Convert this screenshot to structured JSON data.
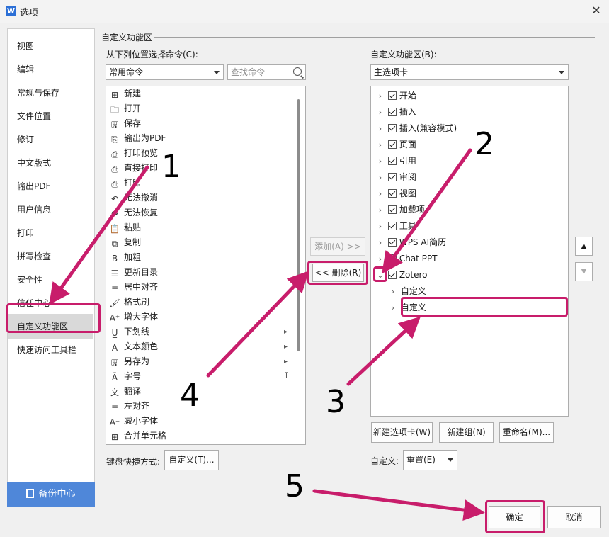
{
  "window": {
    "logo": "W",
    "title": "选项",
    "close_icon": "close-icon"
  },
  "nav": {
    "items": [
      "视图",
      "编辑",
      "常规与保存",
      "文件位置",
      "修订",
      "中文版式",
      "输出PDF",
      "用户信息",
      "打印",
      "拼写检查",
      "安全性",
      "信任中心",
      "自定义功能区",
      "快速访问工具栏"
    ],
    "active_index": 12,
    "backup_label": "备份中心"
  },
  "section": {
    "title": "自定义功能区"
  },
  "left": {
    "label": "从下列位置选择命令(C):",
    "combo_value": "常用命令",
    "search_placeholder": "查找命令",
    "commands": [
      {
        "icon": "new-icon",
        "glyph": "⊞",
        "label": "新建"
      },
      {
        "icon": "open-icon",
        "glyph": "🗀",
        "label": "打开"
      },
      {
        "icon": "save-icon",
        "glyph": "🖫",
        "label": "保存"
      },
      {
        "icon": "export-pdf-icon",
        "glyph": "⎘",
        "label": "输出为PDF"
      },
      {
        "icon": "print-preview-icon",
        "glyph": "⎙",
        "label": "打印预览"
      },
      {
        "icon": "direct-print-icon",
        "glyph": "⎙",
        "label": "直接打印"
      },
      {
        "icon": "print-icon",
        "glyph": "⎙",
        "label": "打印"
      },
      {
        "icon": "undo-icon",
        "glyph": "↶",
        "label": "无法撤消"
      },
      {
        "icon": "redo-icon",
        "glyph": "↷",
        "label": "无法恢复"
      },
      {
        "icon": "paste-icon",
        "glyph": "📋",
        "label": "粘贴"
      },
      {
        "icon": "copy-icon",
        "glyph": "⧉",
        "label": "复制"
      },
      {
        "icon": "bold-icon",
        "glyph": "B",
        "label": "加粗"
      },
      {
        "icon": "update-toc-icon",
        "glyph": "☰",
        "label": "更新目录"
      },
      {
        "icon": "align-center-icon",
        "glyph": "≡",
        "label": "居中对齐"
      },
      {
        "icon": "format-painter-icon",
        "glyph": "🖌",
        "label": "格式刷"
      },
      {
        "icon": "grow-font-icon",
        "glyph": "A⁺",
        "label": "增大字体"
      },
      {
        "icon": "underline-icon",
        "glyph": "U̲",
        "label": "下划线"
      },
      {
        "icon": "font-color-icon",
        "glyph": "A",
        "label": "文本颜色"
      },
      {
        "icon": "save-as-icon",
        "glyph": "🖫",
        "label": "另存为"
      },
      {
        "icon": "font-size-icon",
        "glyph": "Ā",
        "label": "字号"
      },
      {
        "icon": "translate-icon",
        "glyph": "文",
        "label": "翻译"
      },
      {
        "icon": "align-left-icon",
        "glyph": "≡",
        "label": "左对齐"
      },
      {
        "icon": "shrink-font-icon",
        "glyph": "A⁻",
        "label": "减小字体"
      },
      {
        "icon": "merge-cells-icon",
        "glyph": "⊞",
        "label": "合并单元格"
      }
    ],
    "submenu_markers": [
      "▸",
      "▸",
      "▸",
      "Ī"
    ],
    "shortcut_label": "键盘快捷方式:",
    "shortcut_button": "自定义(T)..."
  },
  "middle": {
    "add_button": "添加(A) >>",
    "remove_button": "<< 删除(R)"
  },
  "right": {
    "label": "自定义功能区(B):",
    "combo_value": "主选项卡",
    "tree": [
      {
        "label": "开始",
        "checked": true
      },
      {
        "label": "插入",
        "checked": true
      },
      {
        "label": "插入(兼容模式)",
        "checked": true
      },
      {
        "label": "页面",
        "checked": true
      },
      {
        "label": "引用",
        "checked": true
      },
      {
        "label": "审阅",
        "checked": true
      },
      {
        "label": "视图",
        "checked": true
      },
      {
        "label": "加载项",
        "checked": true
      },
      {
        "label": "工具",
        "checked": true
      },
      {
        "label": "WPS AI简历",
        "checked": true
      },
      {
        "label": "Chat PPT",
        "checked": false
      },
      {
        "label": "Zotero",
        "checked": true
      }
    ],
    "zotero_children": [
      "自定义",
      "自定义"
    ],
    "new_tab_button": "新建选项卡(W)",
    "new_group_button": "新建组(N)",
    "rename_button": "重命名(M)...",
    "customize_label": "自定义:",
    "reset_button": "重置(E)",
    "move_up_icon": "triangle-up-icon",
    "move_down_icon": "triangle-down-icon"
  },
  "footer": {
    "ok_button": "确定",
    "cancel_button": "取消"
  },
  "annotations": {
    "numbers": [
      "1",
      "2",
      "3",
      "4",
      "5"
    ],
    "color": "#c81d6b"
  }
}
